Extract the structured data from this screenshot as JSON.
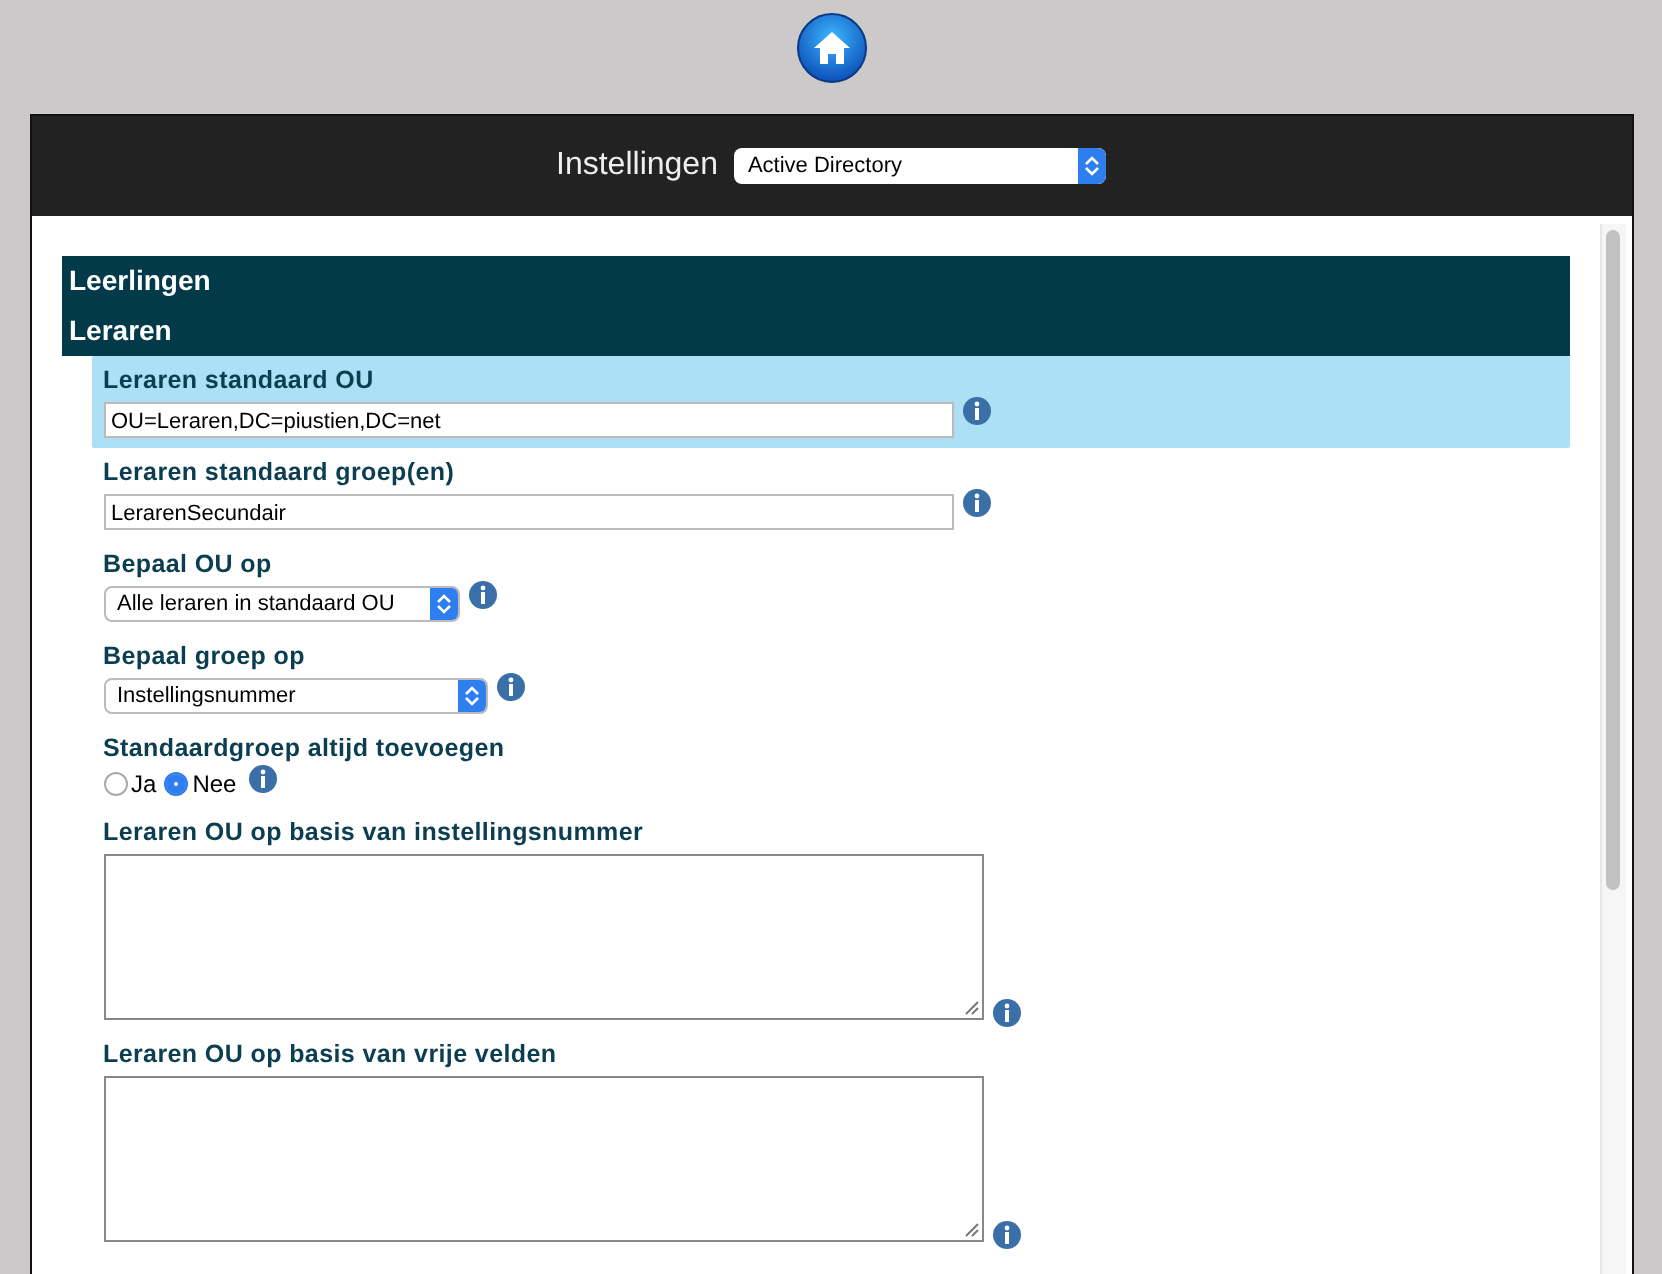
{
  "header": {
    "title": "Instellingen",
    "select_value": "Active Directory"
  },
  "sections": [
    {
      "title": "Leerlingen"
    },
    {
      "title": "Leraren"
    }
  ],
  "fields": [
    {
      "kind": "text",
      "label": "Leraren standaard OU",
      "value": "OU=Leraren,DC=piustien,DC=net",
      "highlighted": true
    },
    {
      "kind": "text",
      "label": "Leraren standaard groep(en)",
      "value": "LerarenSecundair",
      "highlighted": false
    },
    {
      "kind": "select",
      "label": "Bepaal OU op",
      "value": "Alle leraren in standaard OU",
      "highlighted": false
    },
    {
      "kind": "select",
      "label": "Bepaal groep op",
      "value": "Instellingsnummer",
      "highlighted": false
    },
    {
      "kind": "radio",
      "label": "Standaardgroep altijd toevoegen",
      "options": [
        {
          "label": "Ja",
          "selected": false
        },
        {
          "label": "Nee",
          "selected": true
        }
      ],
      "highlighted": false
    },
    {
      "kind": "textarea",
      "label": "Leraren OU op basis van instellingsnummer",
      "highlighted": false
    },
    {
      "kind": "textarea",
      "label": "Leraren OU op basis van vrije velden",
      "highlighted": false
    }
  ]
}
